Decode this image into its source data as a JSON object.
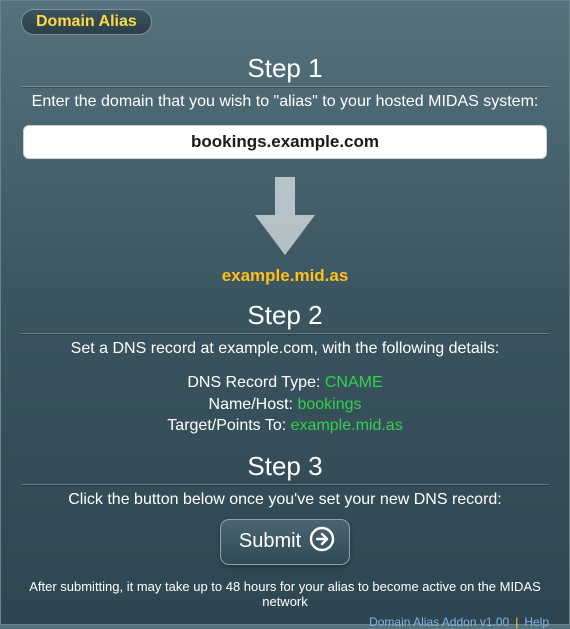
{
  "tab_label": "Domain Alias",
  "step1": {
    "title": "Step 1",
    "subtitle": "Enter the domain that you wish to \"alias\" to your hosted MIDAS system:",
    "input_value": "bookings.example.com",
    "target_domain": "example.mid.as"
  },
  "step2": {
    "title": "Step 2",
    "subtitle": "Set a DNS record at example.com, with the following details:",
    "record_type_label": "DNS Record Type:",
    "record_type_value": "CNAME",
    "name_label": "Name/Host:",
    "name_value": "bookings",
    "target_label": "Target/Points To:",
    "target_value": "example.mid.as"
  },
  "step3": {
    "title": "Step 3",
    "subtitle": "Click the button below once you've set your new DNS record:",
    "button_label": "Submit",
    "note": "After submitting, it may take up to 48 hours for your alias to become active on the MIDAS network"
  },
  "footer": {
    "version": "Domain Alias Addon v1.00",
    "help": "Help"
  }
}
